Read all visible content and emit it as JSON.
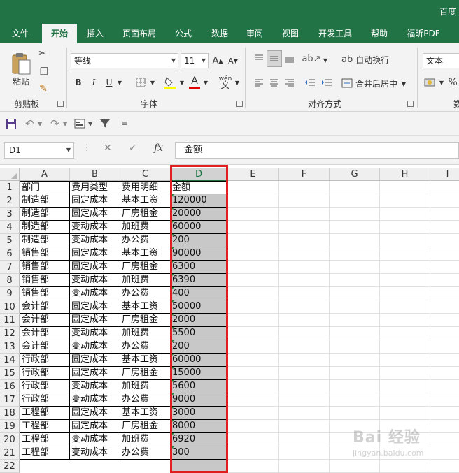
{
  "window": {
    "title": "百度"
  },
  "tabs": [
    "文件",
    "开始",
    "插入",
    "页面布局",
    "公式",
    "数据",
    "审阅",
    "视图",
    "开发工具",
    "帮助",
    "福昕PDF"
  ],
  "active_tab": "开始",
  "ribbon": {
    "clipboard": {
      "label": "剪贴板",
      "paste": "粘贴"
    },
    "font": {
      "label": "字体",
      "name": "等线",
      "size": "11",
      "bold": "B",
      "italic": "I",
      "underline": "U",
      "grow": "A",
      "shrink": "A",
      "font_color_glyph": "A",
      "phonetic": "wén"
    },
    "alignment": {
      "label": "对齐方式",
      "wrap_text": "自动换行",
      "merge_center": "合并后居中"
    },
    "number": {
      "label": "数",
      "format": "文本",
      "percent": "%"
    }
  },
  "formula_bar": {
    "name_box": "D1",
    "cancel": "✕",
    "enter": "✓",
    "fx": "fx",
    "content": "金额"
  },
  "columns": [
    "A",
    "B",
    "C",
    "D",
    "E",
    "F",
    "G",
    "H",
    "I"
  ],
  "selected_column": "D",
  "rows": [
    "1",
    "2",
    "3",
    "4",
    "5",
    "6",
    "7",
    "8",
    "9",
    "10",
    "11",
    "12",
    "13",
    "14",
    "15",
    "16",
    "17",
    "18",
    "19",
    "20",
    "21",
    "22"
  ],
  "table": [
    [
      "部门",
      "费用类型",
      "费用明细",
      "金额"
    ],
    [
      "制造部",
      "固定成本",
      "基本工资",
      "120000"
    ],
    [
      "制造部",
      "固定成本",
      "厂房租金",
      "20000"
    ],
    [
      "制造部",
      "变动成本",
      "加班费",
      "60000"
    ],
    [
      "制造部",
      "变动成本",
      "办公费",
      "200"
    ],
    [
      "销售部",
      "固定成本",
      "基本工资",
      "90000"
    ],
    [
      "销售部",
      "固定成本",
      "厂房租金",
      "6300"
    ],
    [
      "销售部",
      "变动成本",
      "加班费",
      "6390"
    ],
    [
      "销售部",
      "变动成本",
      "办公费",
      "400"
    ],
    [
      "会计部",
      "固定成本",
      "基本工资",
      "50000"
    ],
    [
      "会计部",
      "固定成本",
      "厂房租金",
      "2000"
    ],
    [
      "会计部",
      "变动成本",
      "加班费",
      "5500"
    ],
    [
      "会计部",
      "变动成本",
      "办公费",
      "200"
    ],
    [
      "行政部",
      "固定成本",
      "基本工资",
      "60000"
    ],
    [
      "行政部",
      "固定成本",
      "厂房租金",
      "15000"
    ],
    [
      "行政部",
      "变动成本",
      "加班费",
      "5600"
    ],
    [
      "行政部",
      "变动成本",
      "办公费",
      "9000"
    ],
    [
      "工程部",
      "固定成本",
      "基本工资",
      "3000"
    ],
    [
      "工程部",
      "固定成本",
      "厂房租金",
      "8000"
    ],
    [
      "工程部",
      "变动成本",
      "加班费",
      "6920"
    ],
    [
      "工程部",
      "变动成本",
      "办公费",
      "300"
    ]
  ],
  "watermark": {
    "brand": "Bai 经验",
    "url": "jingyan.baidu.com"
  },
  "colors": {
    "accent": "#217346",
    "highlight_border": "#e02020",
    "selected_fill": "#c8c8c8"
  }
}
